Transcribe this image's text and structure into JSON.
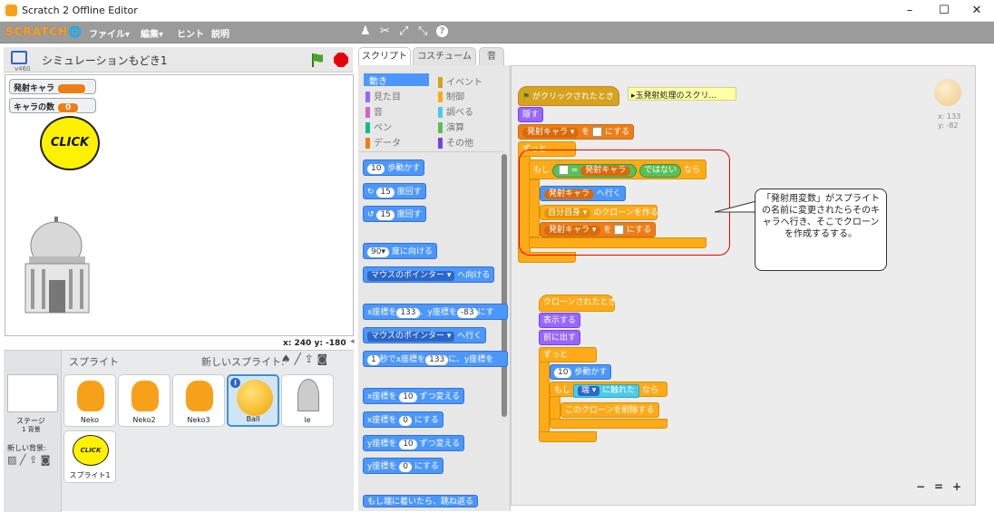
{
  "window": {
    "title": "Scratch 2 Offline Editor",
    "minimize": "–",
    "maximize": "☐",
    "close": "✕"
  },
  "menubar": {
    "logo": "SCRATCH",
    "globe": "🌐",
    "file": "ファイル▾",
    "edit": "編集▾",
    "tips": "ヒント",
    "about": "説明"
  },
  "toolbar": {
    "duplicate": "♟",
    "cut": "✂",
    "grow": "⤢",
    "shrink": "⤡",
    "help": "?"
  },
  "stage_header": {
    "version": "v460",
    "project_title": "シミュレーションもどき1"
  },
  "monitors": [
    {
      "label": "発射キャラ",
      "value": ""
    },
    {
      "label": "キャラの数",
      "value": "0"
    }
  ],
  "stage": {
    "click_text": "CLICK",
    "coords": "x: 240  y: -180"
  },
  "sprite_pane": {
    "title": "スプライト",
    "new_sprite": "新しいスプライト:",
    "stage_label": "ステージ",
    "stage_sub": "1 背景",
    "new_backdrop": "新しい背景:",
    "sprites": [
      "Neko",
      "Neko2",
      "Neko3",
      "Ball",
      "le",
      "スプライト1"
    ]
  },
  "tabs": [
    "スクリプト",
    "コスチューム",
    "音"
  ],
  "categories": [
    {
      "label": "動き",
      "color": "#4c97ff"
    },
    {
      "label": "イベント",
      "color": "#d6a220"
    },
    {
      "label": "見た目",
      "color": "#9966ff"
    },
    {
      "label": "制御",
      "color": "#ffab19"
    },
    {
      "label": "音",
      "color": "#cf63cf"
    },
    {
      "label": "調べる",
      "color": "#4ccbe6"
    },
    {
      "label": "ペン",
      "color": "#0fbd8c"
    },
    {
      "label": "演算",
      "color": "#59c059"
    },
    {
      "label": "データ",
      "color": "#ee7d16"
    },
    {
      "label": "その他",
      "color": "#7744dd"
    }
  ],
  "palette_blocks": {
    "move": {
      "v": "10",
      "t": "歩動かす"
    },
    "turn_right": {
      "v": "15",
      "t": "度回す"
    },
    "turn_left": {
      "v": "15",
      "t": "度回す"
    },
    "point_dir": {
      "v": "90▾",
      "t": "度に向ける"
    },
    "point_towards": {
      "v": "マウスのポインター ▾",
      "t": "へ向ける"
    },
    "goto_xy": {
      "a": "x座標を",
      "x": "133",
      "b": "、y座標を",
      "y": "-83",
      "c": "にす"
    },
    "goto": {
      "v": "マウスのポインター ▾",
      "t": "へ行く"
    },
    "glide": {
      "v": "1",
      "a": "秒でx座標を",
      "x": "133",
      "b": "に、y座標を"
    },
    "change_x": {
      "a": "x座標を",
      "v": "10",
      "b": "ずつ変える"
    },
    "set_x": {
      "a": "x座標を",
      "v": "0",
      "b": "にする"
    },
    "change_y": {
      "a": "y座標を",
      "v": "10",
      "b": "ずつ変える"
    },
    "set_y": {
      "a": "y座標を",
      "v": "0",
      "b": "にする"
    },
    "bounce": {
      "t": "もし端に着いたら、跳ね返る"
    }
  },
  "script1": {
    "hat": "がクリックされたとき",
    "comment": "▸玉発射処理のスクリ...",
    "hide": "隠す",
    "set_var": {
      "var": "発射キャラ ▾",
      "a": "を",
      "b": "にする"
    },
    "forever": "ずっと",
    "if": {
      "a": "もし",
      "eq": "=",
      "var": "発射キャラ",
      "not": "ではない",
      "b": "なら"
    },
    "goto": {
      "var": "発射キャラ",
      "t": "へ行く"
    },
    "clone": {
      "v": "自分自身 ▾",
      "t": "のクローンを作る"
    },
    "set_var2": {
      "var": "発射キャラ ▾",
      "a": "を",
      "b": "にする"
    }
  },
  "script2": {
    "hat": "クローンされたとき",
    "show": "表示する",
    "front": "前に出す",
    "forever": "ずっと",
    "move": {
      "v": "10",
      "t": "歩動かす"
    },
    "if": {
      "a": "もし",
      "v": "端 ▾",
      "t": "に触れた",
      "b": "なら"
    },
    "delete": "このクローンを削除する"
  },
  "sprite_info": {
    "x": "x: 133",
    "y": "y: -82"
  },
  "callout": "「発射用変数」がスプライトの名前に変更されたらそのキャラへ行き、そこでクローンを作成するする。",
  "zoom": {
    "out": "−",
    "reset": "=",
    "in": "+"
  }
}
